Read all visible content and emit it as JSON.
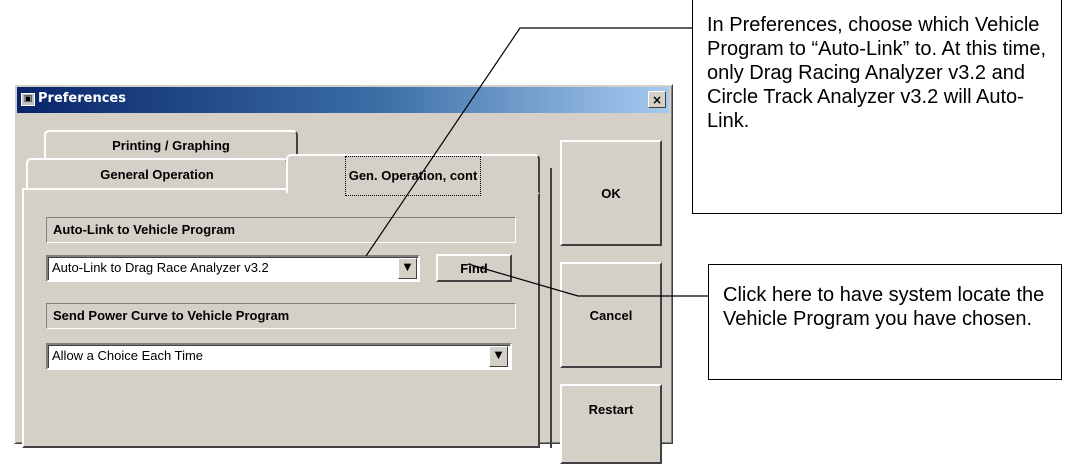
{
  "window": {
    "title": "Preferences",
    "close_label": "×"
  },
  "tabs": {
    "printing": "Printing / Graphing",
    "general": "General Operation",
    "gen_cont": "Gen. Operation, cont"
  },
  "autolink": {
    "label": "Auto-Link to Vehicle Program",
    "value": "Auto-Link to Drag Race Analyzer v3.2",
    "find_label": "Find"
  },
  "power_curve": {
    "label": "Send Power Curve to Vehicle Program",
    "value": "Allow a Choice Each Time"
  },
  "buttons": {
    "ok": "OK",
    "cancel": "Cancel",
    "restart": "Restart"
  },
  "callouts": {
    "top": "In Preferences, choose which Vehicle Program to “Auto-Link” to.  At this time, only Drag Racing Analyzer v3.2 and Circle Track Analyzer v3.2 will Auto-Link.",
    "bottom": "Click here to have system locate the Vehicle Program you have chosen."
  }
}
